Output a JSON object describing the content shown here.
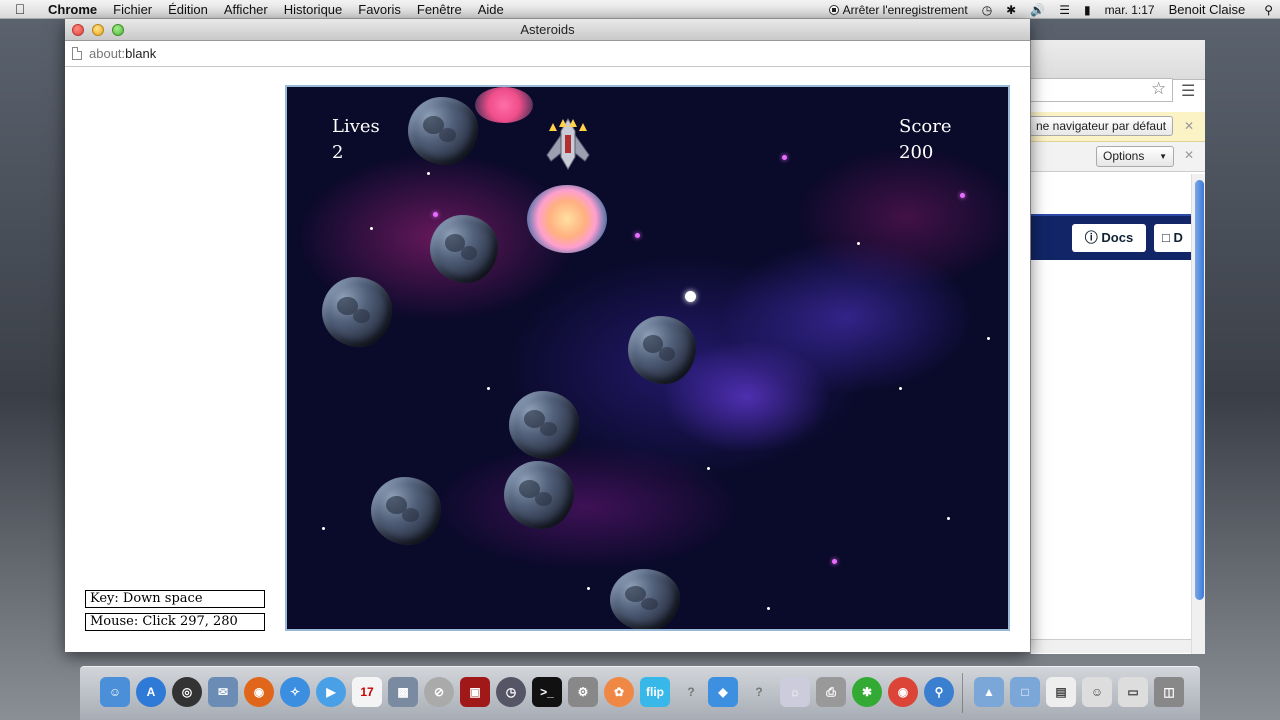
{
  "menubar": {
    "app_name": "Chrome",
    "items": [
      "Fichier",
      "Édition",
      "Afficher",
      "Historique",
      "Favoris",
      "Fenêtre",
      "Aide"
    ],
    "recording": "Arrêter l'enregistrement",
    "clock": "mar. 1:17",
    "user": "Benoit Claise"
  },
  "window": {
    "title": "Asteroids",
    "url_scheme": "about:",
    "url_path": "blank"
  },
  "game": {
    "lives_label": "Lives",
    "lives_value": "2",
    "score_label": "Score",
    "score_value": "200"
  },
  "debug": {
    "key": "Key: Down space",
    "mouse": "Mouse: Click 297, 280"
  },
  "bg_window": {
    "infobar_button": "ne navigateur par défaut",
    "options_label": "Options",
    "docs_label": "Docs",
    "docs2_label": "D"
  },
  "dock": {
    "calendar_day": "17",
    "flip_label": "flip"
  },
  "colors": {
    "nav_band": "#122667",
    "infobar": "#fbf2c6",
    "game_bg": "#0a0a2a"
  }
}
